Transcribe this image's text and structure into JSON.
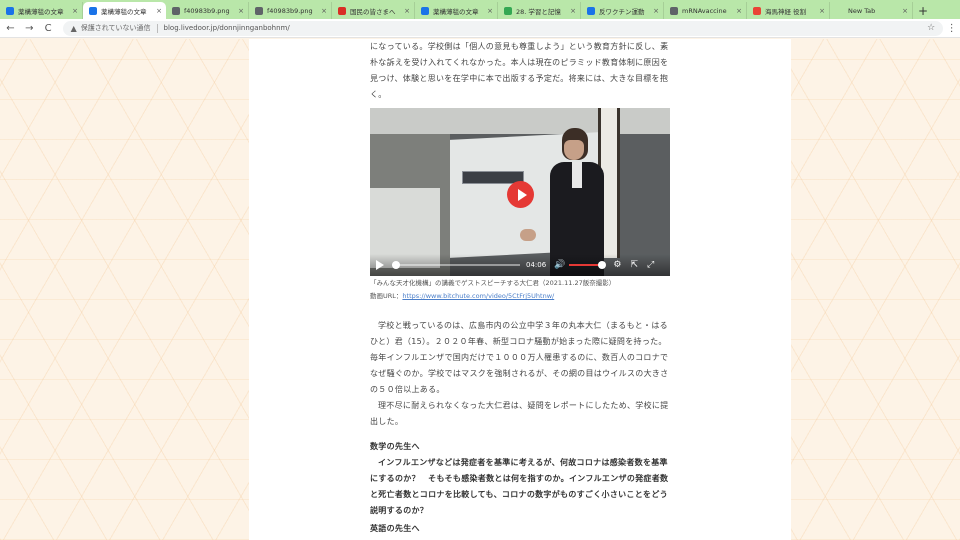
{
  "browser": {
    "tabs": [
      {
        "title": "薬構薄毯の文章",
        "favicon_color": "#1a73e8",
        "active": false
      },
      {
        "title": "薬構薄毯の文章",
        "favicon_color": "#1a73e8",
        "active": true
      },
      {
        "title": "f40983b9.png",
        "favicon_color": "#5f6368",
        "active": false
      },
      {
        "title": "f40983b9.png",
        "favicon_color": "#5f6368",
        "active": false
      },
      {
        "title": "国民の皆さまへ",
        "favicon_color": "#d93025",
        "active": false
      },
      {
        "title": "薬構薄毯の文章",
        "favicon_color": "#1a73e8",
        "active": false
      },
      {
        "title": "28. 学習と記憶",
        "favicon_color": "#34a853",
        "active": false
      },
      {
        "title": "反ワクチン運動",
        "favicon_color": "#1a73e8",
        "active": false
      },
      {
        "title": "mRNAvaccine",
        "favicon_color": "#5f6368",
        "active": false
      },
      {
        "title": "海馬神経 役割",
        "favicon_color": "#ea4335",
        "active": false
      },
      {
        "title": "New Tab",
        "favicon_color": "#b9e7a9",
        "active": false
      }
    ],
    "new_tab_symbol": "+",
    "close_symbol": "×",
    "nav": {
      "back": "←",
      "forward": "→",
      "reload": "C"
    },
    "security_label": "保護されていない通信",
    "url": "blog.livedoor.jp/donnjinnganbohnm/",
    "menu_symbol": "⋮",
    "bookmark_star": "☆"
  },
  "article": {
    "intro": "になっている。学校側は「個人の意見も尊重しよう」という教育方針に反し、素朴な訴えを受け入れてくれなかった。本人は現在のピラミッド教育体制に原因を見つけ、体験と思いを在学中に本で出版する予定だ。将来には、大きな目標を抱く。",
    "video": {
      "time": "04:06",
      "progress": 0.0,
      "volume": 1.0
    },
    "caption": "「みんな天才化機構」の講義でゲストスピーチする大仁君（2021.11.27飯奈撮影）",
    "video_url_label": "動画URL：",
    "video_url": "https://www.bitchute.com/video/5CtFrj5Uhtnw/",
    "para1": "学校と戦っているのは、広島市内の公立中学３年の丸本大仁（まるもと・はるひと）君（15）。２０２０年春、新型コロナ騒動が始まった際に疑問を持った。毎年インフルエンザで国内だけで１０００万人罹患するのに、数百人のコロナでなぜ騒ぐのか。学校ではマスクを強制されるが、その網の目はウイルスの大きさの５０倍以上ある。",
    "para2": "理不尽に耐えられなくなった大仁君は、疑問をレポートにしたため、学校に提出した。",
    "heading1": "数学の先生へ",
    "bold1": "インフルエンザなどは発症者を基準に考えるが、何故コロナは感染者数を基準にするのか？　そもそも感染者数とは何を指すのか。インフルエンザの発症者数と死亡者数とコロナを比較しても、コロナの数字がものすごく小さいことをどう説明するのか？",
    "heading2": "英語の先生へ"
  }
}
